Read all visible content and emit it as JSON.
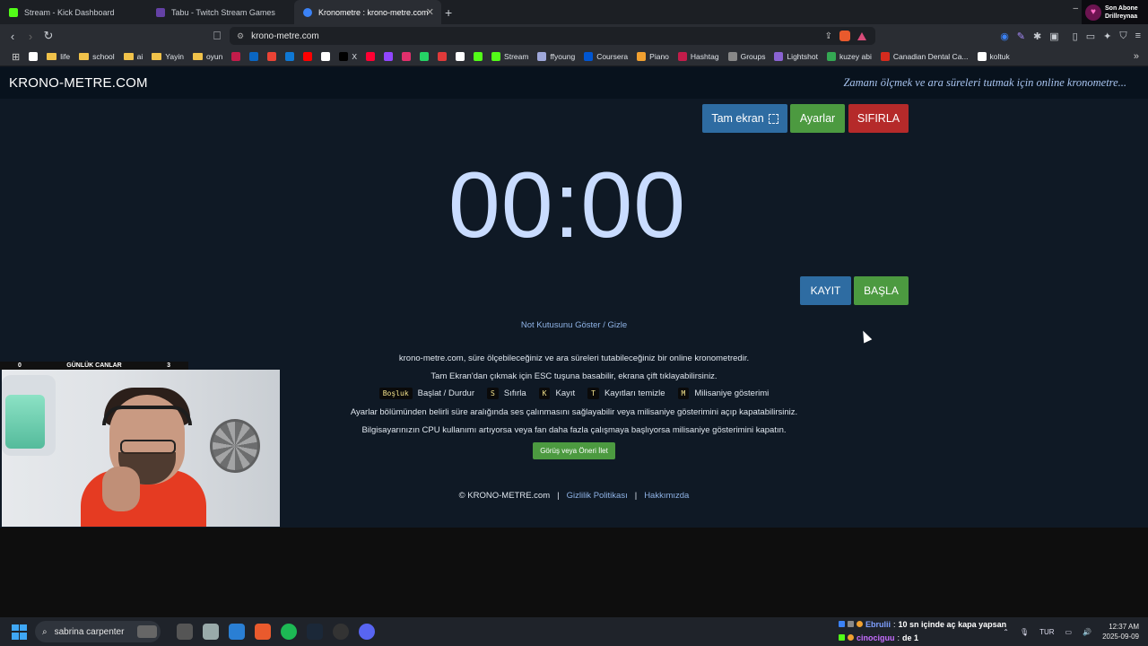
{
  "browser": {
    "tabs": [
      {
        "title": "Stream - Kick Dashboard",
        "favicon_color": "#53fc18",
        "active": false
      },
      {
        "title": "Tabu - Twitch Stream Games",
        "favicon_color": "#6441a5",
        "active": false
      },
      {
        "title": "Kronometre : krono-metre.com",
        "favicon_color": "#3b82f6",
        "active": true
      }
    ],
    "new_tab_label": "+",
    "url": "krono-metre.com",
    "corner_overlay": {
      "line1": "Son Abone",
      "line2": "Drillreynaa"
    },
    "bookmarks": [
      {
        "label": "",
        "icon": "google-icon",
        "color": "#ffffff"
      },
      {
        "label": "life",
        "icon": "folder-icon",
        "color": "#f0c24a"
      },
      {
        "label": "school",
        "icon": "folder-icon",
        "color": "#f0c24a"
      },
      {
        "label": "ai",
        "icon": "folder-icon",
        "color": "#f0c24a"
      },
      {
        "label": "Yayin",
        "icon": "folder-icon",
        "color": "#f0c24a"
      },
      {
        "label": "oyun",
        "icon": "folder-icon",
        "color": "#f0c24a"
      },
      {
        "label": "",
        "icon": "red-circle-icon",
        "color": "#c21c4a"
      },
      {
        "label": "",
        "icon": "linkedin-icon",
        "color": "#0a66c2"
      },
      {
        "label": "",
        "icon": "gmail-icon",
        "color": "#ea4335"
      },
      {
        "label": "",
        "icon": "outlook-icon",
        "color": "#0f78d4"
      },
      {
        "label": "",
        "icon": "youtube-icon",
        "color": "#ff0000"
      },
      {
        "label": "",
        "icon": "grammarly-icon",
        "color": "#ffffff"
      },
      {
        "label": "X",
        "icon": "x-icon",
        "color": "#000000"
      },
      {
        "label": "",
        "icon": "youtube-music-icon",
        "color": "#ff0033"
      },
      {
        "label": "",
        "icon": "twitch-icon",
        "color": "#9146ff"
      },
      {
        "label": "",
        "icon": "instagram-icon",
        "color": "#e1306c"
      },
      {
        "label": "",
        "icon": "whatsapp-icon",
        "color": "#25d366"
      },
      {
        "label": "",
        "icon": "tumblr-icon",
        "color": "#e03a3a"
      },
      {
        "label": "",
        "icon": "amazon-icon",
        "color": "#ffffff"
      },
      {
        "label": "",
        "icon": "kick-icon",
        "color": "#53fc18"
      },
      {
        "label": "Stream",
        "icon": "kick-icon",
        "color": "#53fc18"
      },
      {
        "label": "ffyoung",
        "icon": "link-icon",
        "color": "#9fa8da"
      },
      {
        "label": "Coursera",
        "icon": "coursera-icon",
        "color": "#0056d2"
      },
      {
        "label": "Piano",
        "icon": "piano-icon",
        "color": "#f0a030"
      },
      {
        "label": "Hashtag",
        "icon": "hashtag-icon",
        "color": "#c21c4a"
      },
      {
        "label": "Groups",
        "icon": "groups-icon",
        "color": "#888888"
      },
      {
        "label": "Lightshot",
        "icon": "lightshot-icon",
        "color": "#8a63d2"
      },
      {
        "label": "kuzey abi",
        "icon": "drive-icon",
        "color": "#34a853"
      },
      {
        "label": "Canadian Dental Ca...",
        "icon": "maple-icon",
        "color": "#d52b1e"
      },
      {
        "label": "koltuk",
        "icon": "amazon-icon",
        "color": "#ffffff"
      }
    ]
  },
  "site": {
    "logo": "KRONO-METRE.COM",
    "tagline": "Zamanı ölçmek ve ara süreleri tutmak için online kronometre...",
    "buttons": {
      "fullscreen": "Tam ekran",
      "settings": "Ayarlar",
      "reset": "SIFIRLA",
      "record": "KAYIT",
      "start": "BAŞLA",
      "feedback": "Görüş veya Öneri İlet"
    },
    "timer": "00:00",
    "toggle_notes": "Not Kutusunu Göster / Gizle",
    "info": [
      "krono-metre.com, süre ölçebileceğiniz ve ara süreleri tutabileceğiniz bir online kronometredir.",
      "Tam Ekran'dan çıkmak için ESC tuşuna basabilir, ekrana çift tıklayabilirsiniz.",
      "Ayarlar bölümünden belirli süre aralığında ses çalınmasını sağlayabilir veya milisaniye gösterimini açıp kapatabilirsiniz.",
      "Bilgisayarınızın CPU kullanımı artıyorsa veya fan daha fazla çalışmaya başlıyorsa milisaniye gösterimini kapatın."
    ],
    "shortcuts": [
      {
        "key": "Boşluk",
        "label": "Başlat / Durdur"
      },
      {
        "key": "S",
        "label": "Sıfırla"
      },
      {
        "key": "K",
        "label": "Kayıt"
      },
      {
        "key": "T",
        "label": "Kayıtları temizle"
      },
      {
        "key": "M",
        "label": "Milisaniye gösterimi"
      }
    ],
    "footer": {
      "copyright": "© KRONO-METRE.com",
      "sep1": "|",
      "privacy": "Gizlilik Politikası",
      "sep2": "|",
      "about": "Hakkımızda"
    }
  },
  "stream_overlay": {
    "left_count": "0",
    "title": "GÜNLÜK CANLAR",
    "right_count": "3"
  },
  "taskbar": {
    "search_text": "sabrina carpenter",
    "chat": [
      {
        "user": "Ebrulii",
        "sep": ":",
        "message": "10 sn içinde aç kapa yapsan"
      },
      {
        "user": "cinociguu",
        "sep": ":",
        "message": "de 1"
      }
    ],
    "language": "TUR",
    "time": "12:37 AM",
    "date": "2025-09-09"
  }
}
